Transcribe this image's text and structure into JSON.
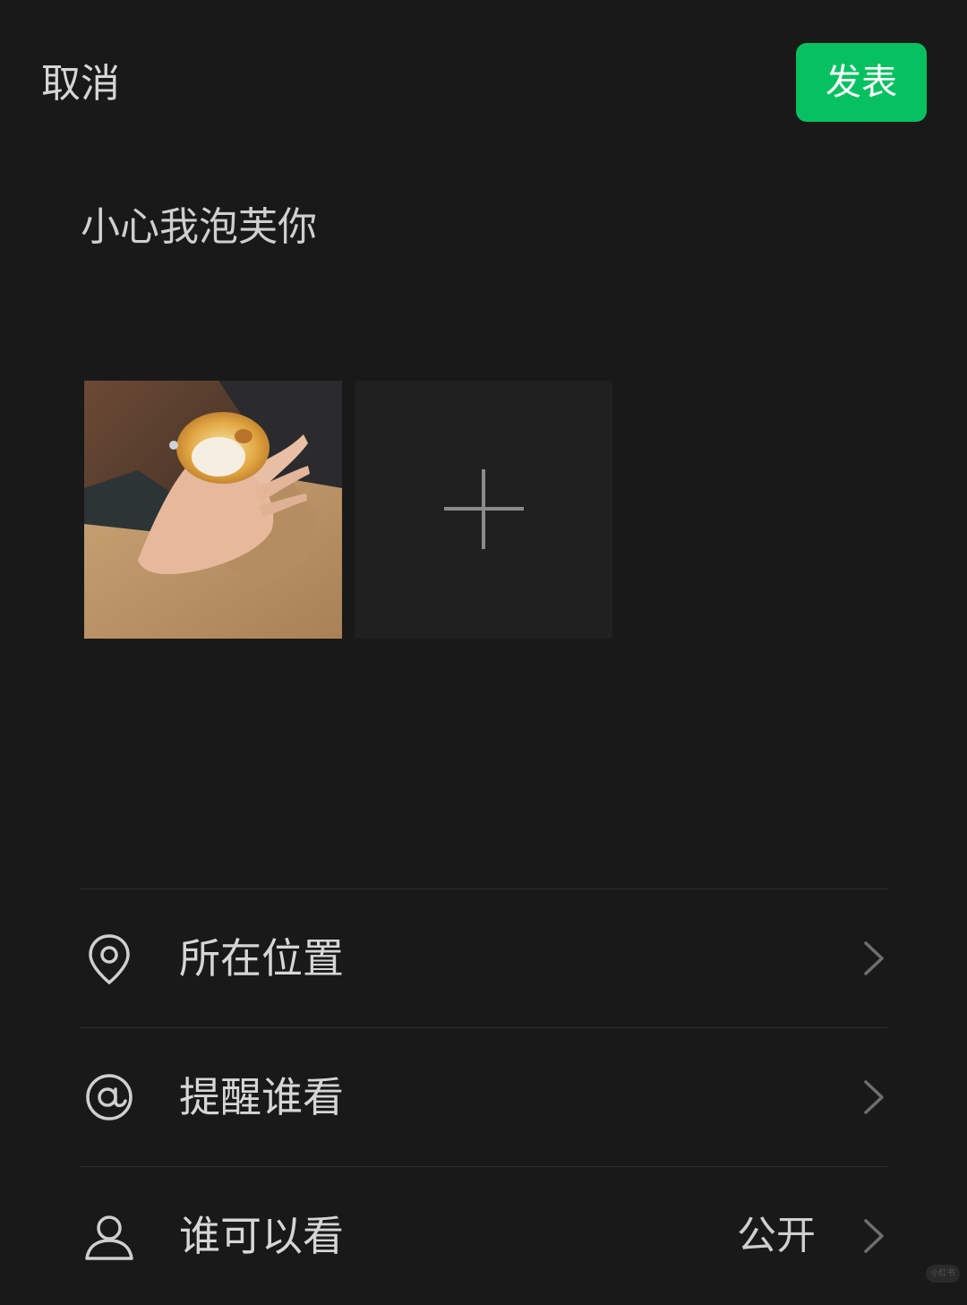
{
  "header": {
    "cancel_label": "取消",
    "publish_label": "发表",
    "publish_color": "#07c160"
  },
  "post": {
    "text": "小心我泡芙你"
  },
  "media": {
    "photos": [
      {
        "icon": "cream-puff-photo"
      }
    ],
    "add_icon": "plus-icon"
  },
  "options": [
    {
      "icon": "location-pin-icon",
      "label": "所在位置",
      "value": ""
    },
    {
      "icon": "at-sign-icon",
      "label": "提醒谁看",
      "value": ""
    },
    {
      "icon": "person-icon",
      "label": "谁可以看",
      "value": "公开"
    }
  ],
  "watermark": {
    "text": "小红书"
  }
}
